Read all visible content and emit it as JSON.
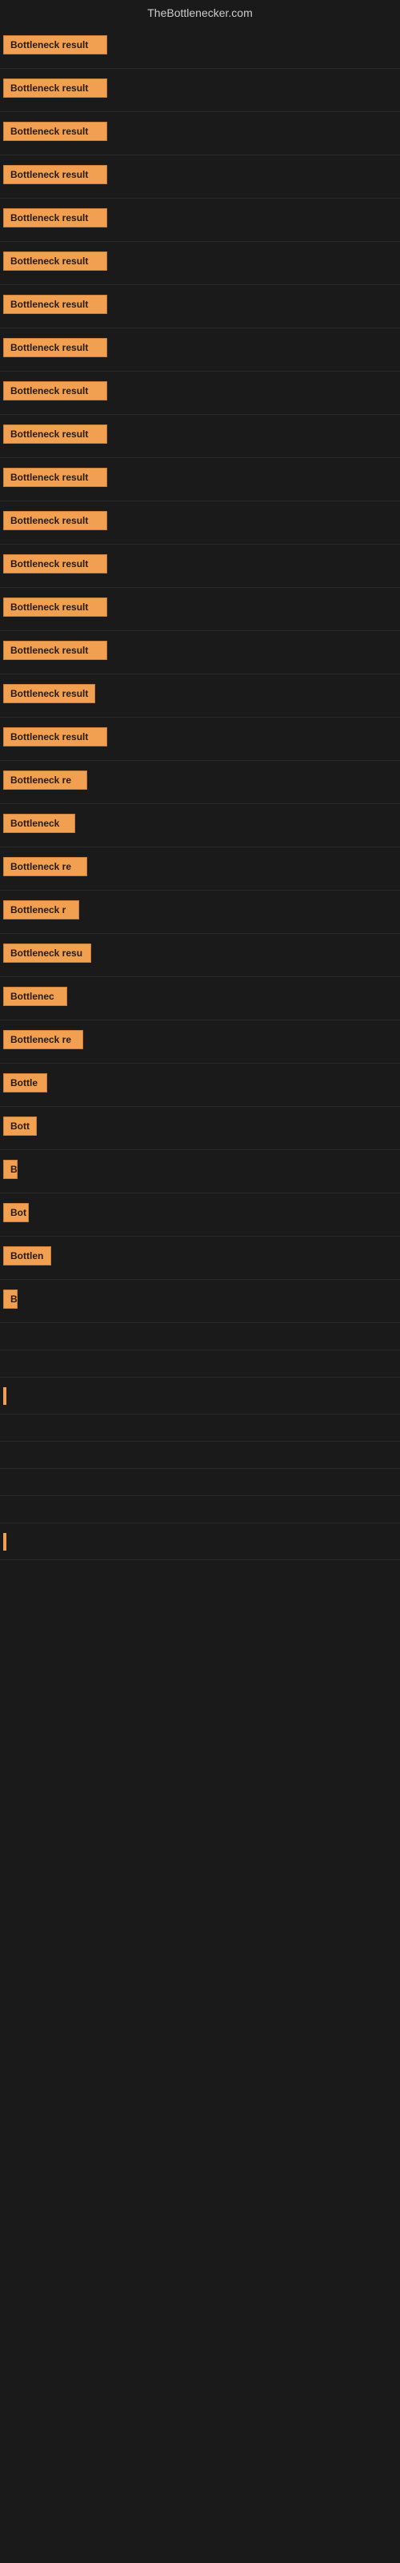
{
  "site": {
    "title": "TheBottlenecker.com"
  },
  "rows": [
    {
      "label": "Bottleneck result",
      "width": 130
    },
    {
      "label": "Bottleneck result",
      "width": 130
    },
    {
      "label": "Bottleneck result",
      "width": 130
    },
    {
      "label": "Bottleneck result",
      "width": 130
    },
    {
      "label": "Bottleneck result",
      "width": 130
    },
    {
      "label": "Bottleneck result",
      "width": 130
    },
    {
      "label": "Bottleneck result",
      "width": 130
    },
    {
      "label": "Bottleneck result",
      "width": 130
    },
    {
      "label": "Bottleneck result",
      "width": 130
    },
    {
      "label": "Bottleneck result",
      "width": 130
    },
    {
      "label": "Bottleneck result",
      "width": 130
    },
    {
      "label": "Bottleneck result",
      "width": 130
    },
    {
      "label": "Bottleneck result",
      "width": 130
    },
    {
      "label": "Bottleneck result",
      "width": 130
    },
    {
      "label": "Bottleneck result",
      "width": 130
    },
    {
      "label": "Bottleneck result",
      "width": 115
    },
    {
      "label": "Bottleneck result",
      "width": 130
    },
    {
      "label": "Bottleneck re",
      "width": 105
    },
    {
      "label": "Bottleneck",
      "width": 90
    },
    {
      "label": "Bottleneck re",
      "width": 105
    },
    {
      "label": "Bottleneck r",
      "width": 95
    },
    {
      "label": "Bottleneck resu",
      "width": 110
    },
    {
      "label": "Bottlenec",
      "width": 80
    },
    {
      "label": "Bottleneck re",
      "width": 100
    },
    {
      "label": "Bottle",
      "width": 55
    },
    {
      "label": "Bott",
      "width": 42
    },
    {
      "label": "B",
      "width": 16
    },
    {
      "label": "Bot",
      "width": 32
    },
    {
      "label": "Bottlen",
      "width": 60
    },
    {
      "label": "B",
      "width": 14
    },
    {
      "label": "",
      "width": 0
    },
    {
      "label": "",
      "width": 0
    },
    {
      "label": "|",
      "width": 8
    },
    {
      "label": "",
      "width": 0
    },
    {
      "label": "",
      "width": 0
    },
    {
      "label": "",
      "width": 0
    },
    {
      "label": "",
      "width": 0
    },
    {
      "label": "|",
      "width": 8
    }
  ]
}
